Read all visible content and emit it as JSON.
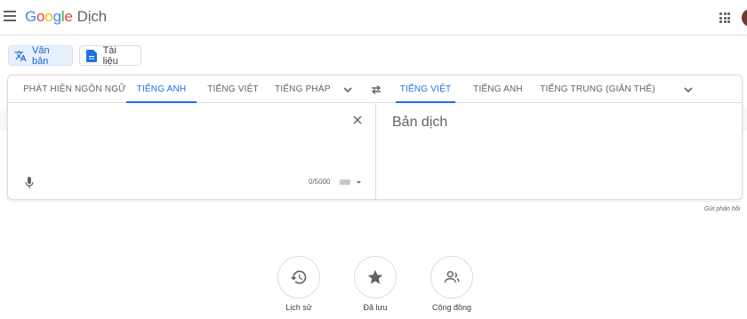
{
  "app": {
    "logo_text": "Google",
    "service": "Dịch"
  },
  "colors": {
    "accent": "#1a73e8",
    "active_mode_bg": "#e8f0fe",
    "icon_gray": "#5f6368",
    "logo": [
      "#4285f4",
      "#ea4335",
      "#fbbc05",
      "#4285f4",
      "#34a853",
      "#ea4335"
    ]
  },
  "modes": {
    "text_label": "Văn bản",
    "docs_label": "Tài liệu",
    "text_icon": "translate-icon",
    "docs_icon": "document-icon"
  },
  "source_langs": [
    "PHÁT HIỆN NGÔN NGỮ",
    "TIẾNG ANH",
    "TIẾNG VIỆT",
    "TIẾNG PHÁP"
  ],
  "source_selected": "TIẾNG ANH",
  "target_langs": [
    "TIẾNG VIỆT",
    "TIẾNG ANH",
    "TIẾNG TRUNG (GIẢN THỂ)"
  ],
  "target_selected": "TIẾNG VIỆT",
  "source": {
    "value": "",
    "char_count": "0/5000"
  },
  "target": {
    "placeholder": "Bản dịch"
  },
  "feedback": "Gửi phản hồi",
  "actions": {
    "history": "Lịch sử",
    "saved": "Đã lưu",
    "community": "Cộng đồng"
  }
}
